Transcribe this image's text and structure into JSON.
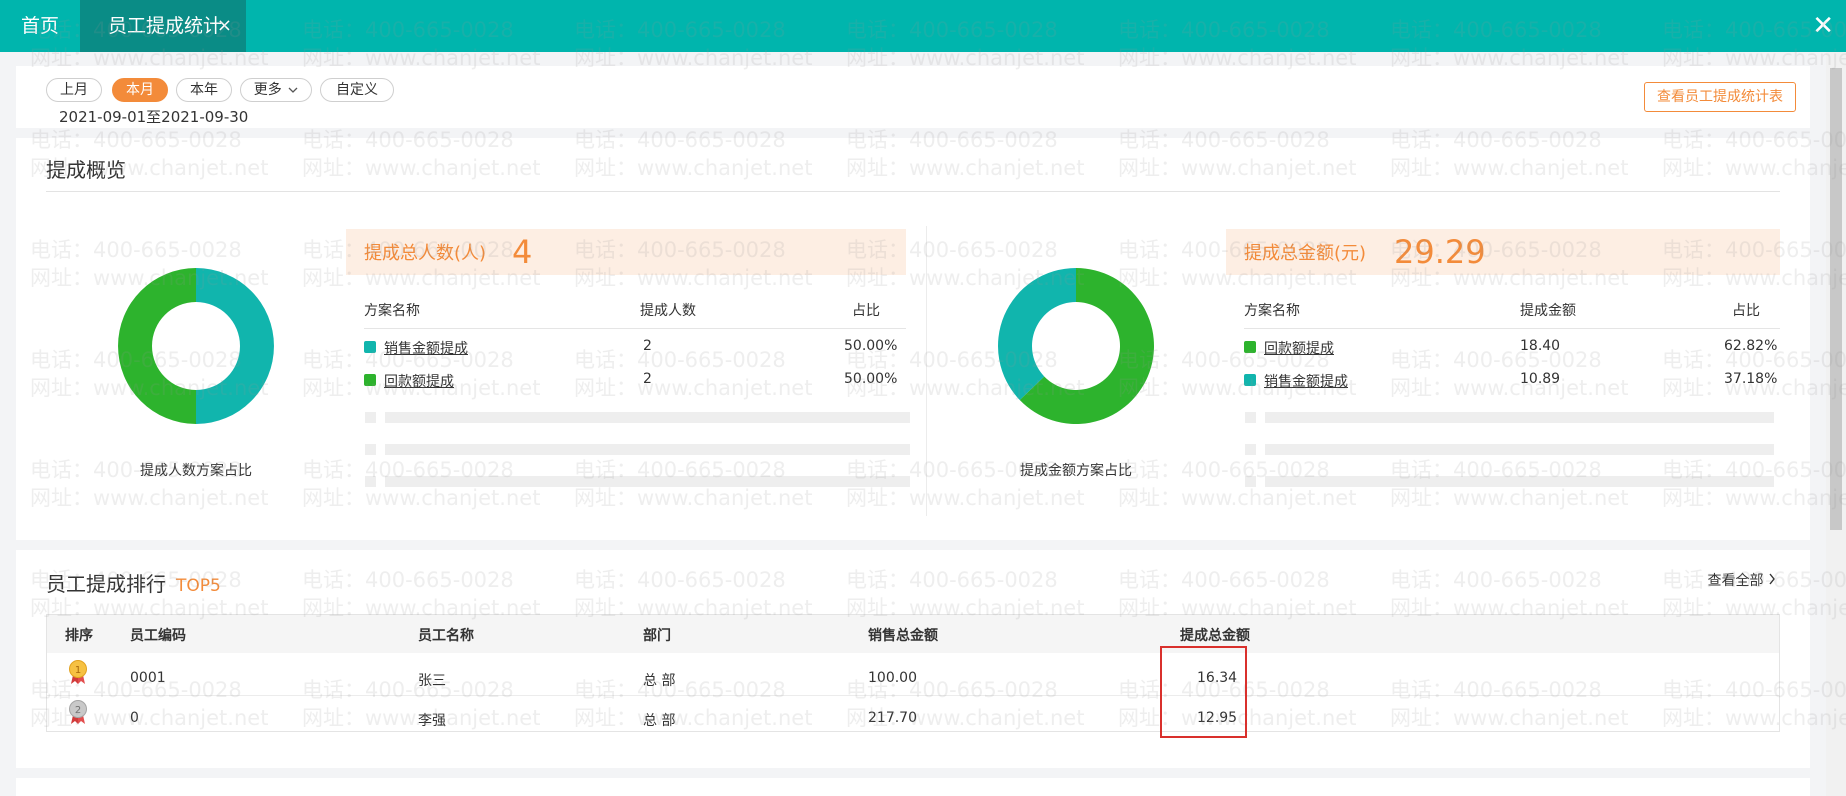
{
  "tabs": {
    "home": "首页",
    "active": "员工提成统计",
    "close_glyph": "×"
  },
  "window": {
    "close_glyph": "✕"
  },
  "filter": {
    "buttons": [
      {
        "label": "上月",
        "active": false
      },
      {
        "label": "本月",
        "active": true
      },
      {
        "label": "本年",
        "active": false
      },
      {
        "label": "更多",
        "active": false
      },
      {
        "label": "自定义",
        "active": false
      }
    ],
    "more_chevron": "chevron-down-icon",
    "date_range": "2021-09-01至2021-09-30",
    "report_button": "查看员工提成统计表"
  },
  "overview": {
    "title": "提成概览",
    "people": {
      "chart_label": "提成人数方案占比",
      "banner_label": "提成总人数(人)",
      "banner_value": "4",
      "headers": [
        "方案名称",
        "提成人数",
        "占比"
      ],
      "rows": [
        {
          "name": "销售金额提成",
          "value": "2",
          "pct": "50.00%",
          "color": "#11b5ad"
        },
        {
          "name": "回款额提成",
          "value": "2",
          "pct": "50.00%",
          "color": "#2db32d"
        }
      ]
    },
    "amount": {
      "chart_label": "提成金额方案占比",
      "banner_label": "提成总金额(元)",
      "banner_value": "29.29",
      "headers": [
        "方案名称",
        "提成金额",
        "占比"
      ],
      "rows": [
        {
          "name": "回款额提成",
          "value": "18.40",
          "pct": "62.82%",
          "color": "#2db32d"
        },
        {
          "name": "销售金额提成",
          "value": "10.89",
          "pct": "37.18%",
          "color": "#11b5ad"
        }
      ]
    }
  },
  "chart_data": [
    {
      "type": "pie",
      "title": "提成人数方案占比",
      "categories": [
        "销售金额提成",
        "回款额提成"
      ],
      "values": [
        2,
        2
      ],
      "colors": [
        "#11b5ad",
        "#2db32d"
      ]
    },
    {
      "type": "pie",
      "title": "提成金额方案占比",
      "categories": [
        "回款额提成",
        "销售金额提成"
      ],
      "values": [
        18.4,
        10.89
      ],
      "colors": [
        "#2db32d",
        "#11b5ad"
      ]
    }
  ],
  "ranking": {
    "title": "员工提成排行",
    "badge": "TOP5",
    "view_all": "查看全部",
    "view_all_chevron": "chevron-right-icon",
    "headers": [
      "排序",
      "员工编码",
      "员工名称",
      "部门",
      "销售总金额",
      "提成总金额"
    ],
    "rows": [
      {
        "medal": "gold-medal-icon",
        "code": "0001",
        "name": "张三",
        "dept": "总 部",
        "sales": "100.00",
        "commission": "16.34"
      },
      {
        "medal": "silver-medal-icon",
        "code": "0",
        "name": "李强",
        "dept": "总 部",
        "sales": "217.70",
        "commission": "12.95"
      }
    ]
  },
  "watermark": {
    "phone": "电话：400-665-0028",
    "site": "网址：www.chanjet.net"
  }
}
